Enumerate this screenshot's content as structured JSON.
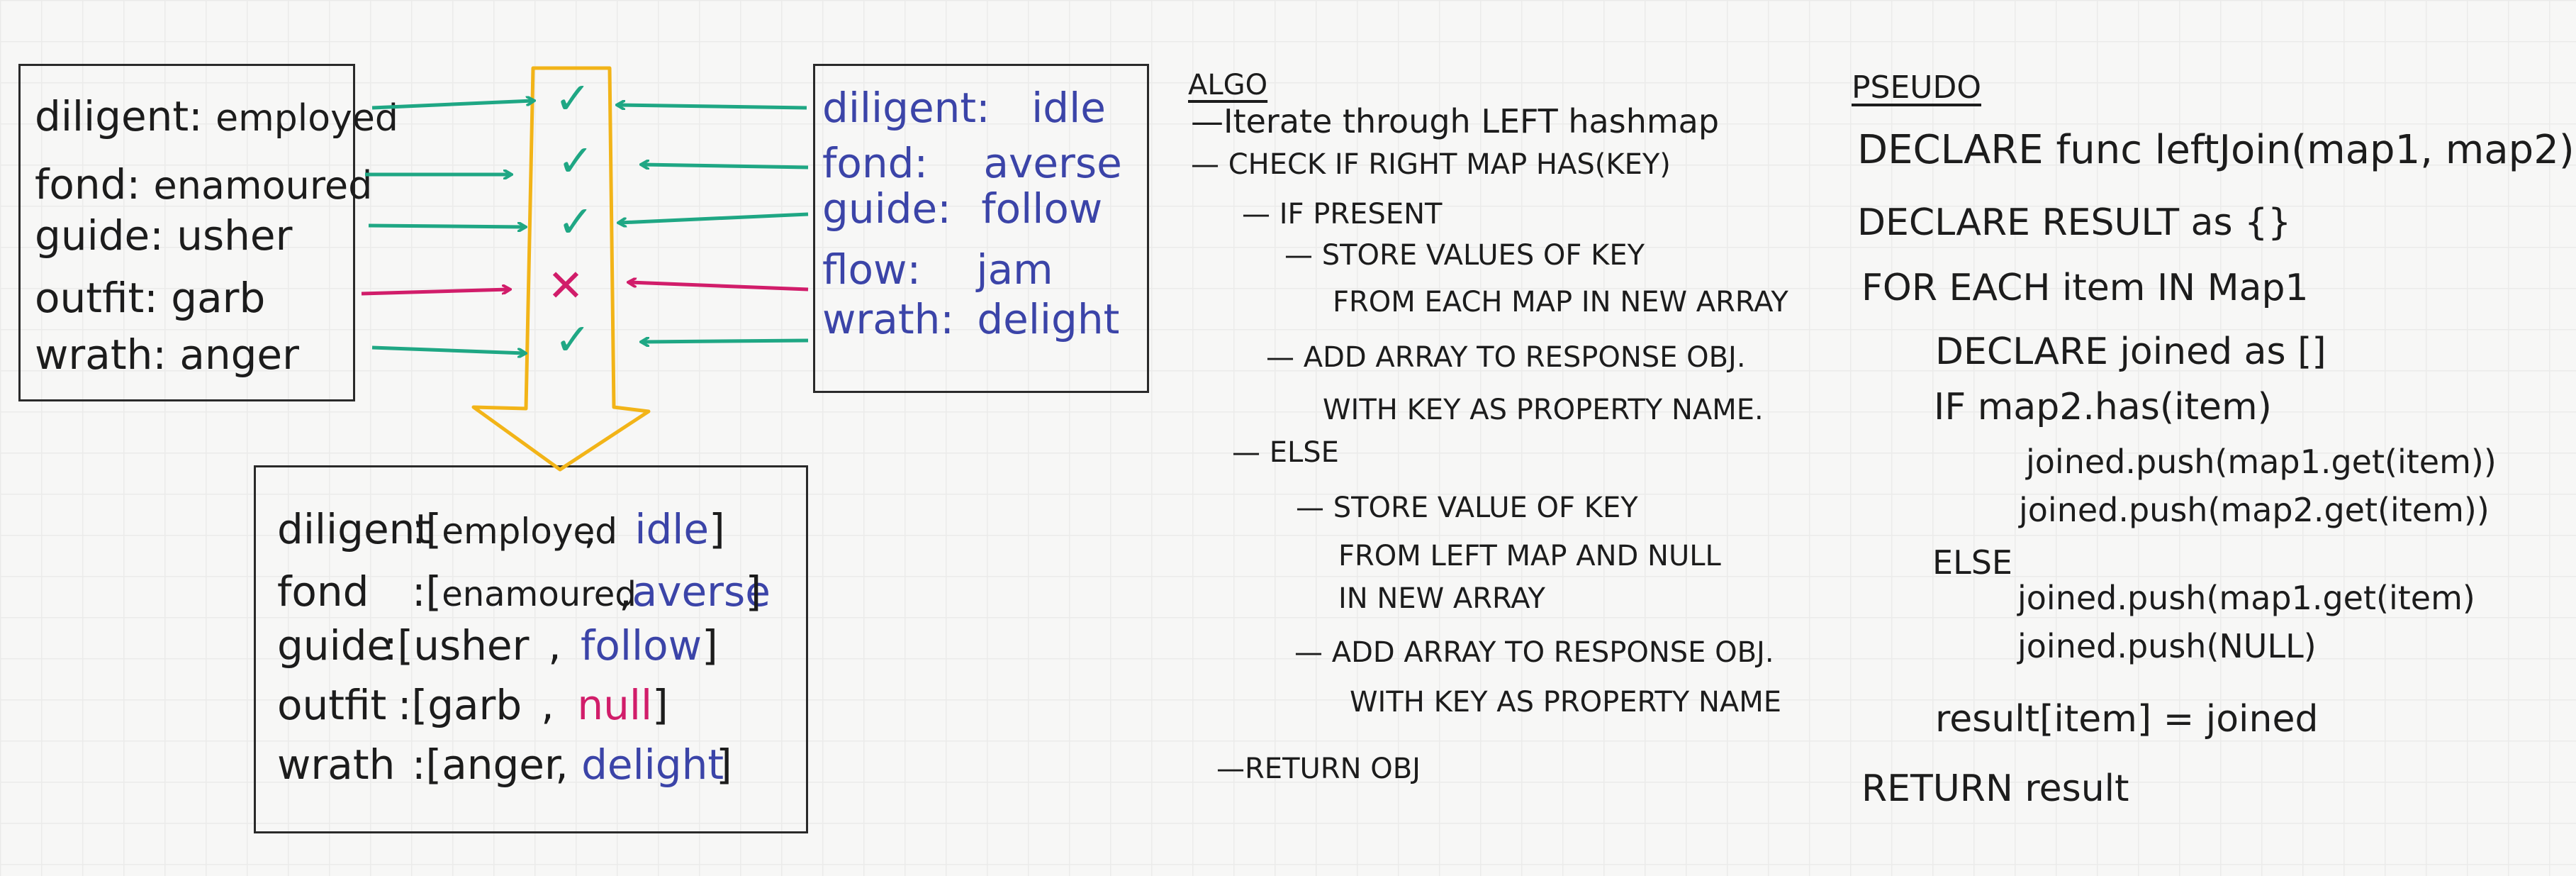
{
  "left_map": [
    {
      "key": "diligent",
      "value": "employed"
    },
    {
      "key": "fond",
      "value": "enamoured"
    },
    {
      "key": "guide",
      "value": "usher"
    },
    {
      "key": "outfit",
      "value": "garb"
    },
    {
      "key": "wrath",
      "value": "anger"
    }
  ],
  "right_map": [
    {
      "key": "diligent",
      "value": "idle"
    },
    {
      "key": "fond",
      "value": "averse"
    },
    {
      "key": "guide",
      "value": "follow"
    },
    {
      "key": "flow",
      "value": "jam"
    },
    {
      "key": "wrath",
      "value": "delight"
    }
  ],
  "matches": [
    "check",
    "check",
    "check",
    "cross",
    "check"
  ],
  "marks": {
    "check": "✓",
    "cross": "✕"
  },
  "result_map": [
    {
      "key": "diligent",
      "left": "employed",
      "right": "idle"
    },
    {
      "key": "fond",
      "left": "enamoured",
      "right": "averse"
    },
    {
      "key": "guide",
      "left": "usher",
      "right": "follow"
    },
    {
      "key": "outfit",
      "left": "garb",
      "right": "null"
    },
    {
      "key": "wrath",
      "left": "anger",
      "right": "delight"
    }
  ],
  "colors": {
    "green": "#1fa784",
    "pink": "#d11d6a",
    "yellow": "#f2b418",
    "blue": "#3b44a8",
    "ink": "#1c1c1c"
  },
  "algo": {
    "heading": "ALGO",
    "lines": [
      "—Iterate through LEFT hashmap",
      "— CHECK IF RIGHT MAP HAS(KEY)",
      "— IF PRESENT",
      "— STORE VALUES OF KEY",
      "FROM EACH MAP IN NEW ARRAY",
      "— ADD ARRAY TO RESPONSE OBJ.",
      "WITH KEY AS PROPERTY NAME.",
      "— ELSE",
      "— STORE VALUE OF KEY",
      "FROM LEFT MAP AND NULL",
      "IN NEW ARRAY",
      "— ADD ARRAY TO RESPONSE OBJ.",
      "WITH KEY AS PROPERTY NAME",
      "—RETURN OBJ"
    ]
  },
  "pseudo": {
    "heading": "PSEUDO",
    "lines": [
      "DECLARE func leftJoin(map1, map2)",
      "DECLARE RESULT as {}",
      "FOR EACH item IN Map1",
      "DECLARE joined as []",
      "IF map2.has(item)",
      "joined.push(map1.get(item))",
      "joined.push(map2.get(item))",
      "ELSE",
      "joined.push(map1.get(item)",
      "joined.push(NULL)",
      "result[item] = joined",
      "RETURN result"
    ]
  }
}
